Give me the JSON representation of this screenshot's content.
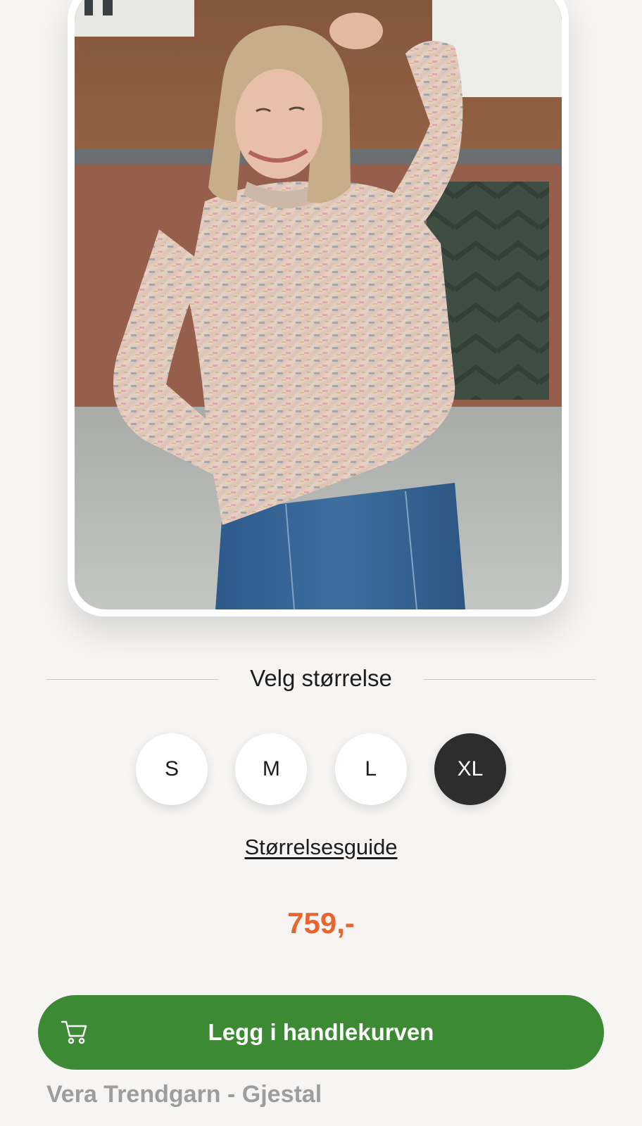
{
  "product": {
    "name": "Vera Trendgarn - Gjestal",
    "price": "759,-"
  },
  "size_selector": {
    "title": "Velg størrelse",
    "sizes": [
      {
        "label": "S",
        "selected": false
      },
      {
        "label": "M",
        "selected": false
      },
      {
        "label": "L",
        "selected": false
      },
      {
        "label": "XL",
        "selected": true
      }
    ],
    "guide_link": "Størrelsesguide"
  },
  "cart_button": {
    "label": "Legg i handlekurven",
    "icon": "cart-icon"
  },
  "colors": {
    "accent_green": "#3c8a33",
    "price_orange": "#e9652e",
    "selected_size": "#2d2d2d",
    "background": "#f6f5f3"
  }
}
